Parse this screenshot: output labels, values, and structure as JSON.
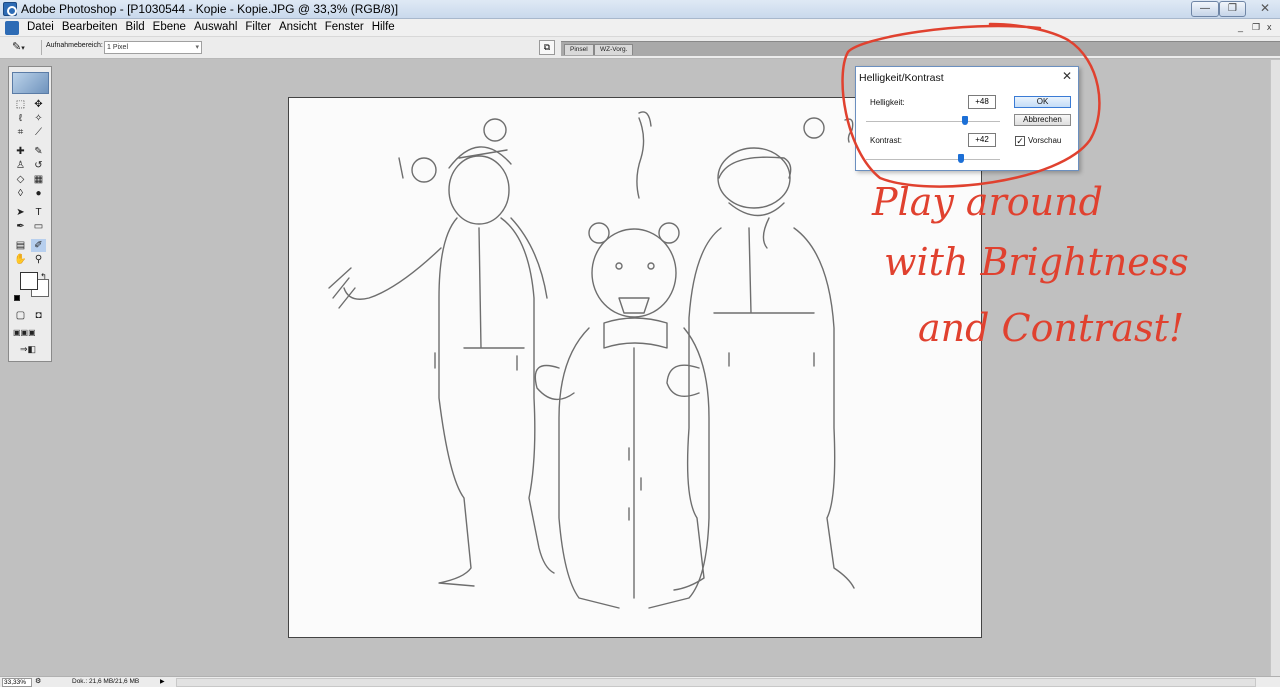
{
  "window": {
    "title": "Adobe Photoshop - [P1030544 - Kopie - Kopie.JPG @ 33,3% (RGB/8)]",
    "minimize_glyph": "—",
    "maximize_glyph": "❐",
    "close_glyph": "✕"
  },
  "menu": {
    "items": [
      "Datei",
      "Bearbeiten",
      "Bild",
      "Ebene",
      "Auswahl",
      "Filter",
      "Ansicht",
      "Fenster",
      "Hilfe"
    ],
    "doc_min": "_",
    "doc_restore": "❐",
    "doc_close": "x"
  },
  "options": {
    "sample_label": "Aufnahmebereich:",
    "sample_value": "1 Pixel",
    "tabs": [
      "Pinsel",
      "WZ-Vorg."
    ]
  },
  "dialog": {
    "title": "Helligkeit/Kontrast",
    "brightness_label": "Helligkeit:",
    "brightness_value": "+48",
    "brightness_level": 0.74,
    "contrast_label": "Kontrast:",
    "contrast_value": "+42",
    "contrast_level": 0.71,
    "ok_label": "OK",
    "cancel_label": "Abbrechen",
    "preview_label": "Vorschau",
    "preview_checked": "✓"
  },
  "annotation": {
    "lines": [
      "Play around",
      "with Brightness",
      "and Contrast!"
    ],
    "color": "#e0412f"
  },
  "status": {
    "zoom": "33,33%",
    "doc_info": "Dok.: 21,6 MB/21,6 MB"
  },
  "accent_color": "#1c6fd6"
}
